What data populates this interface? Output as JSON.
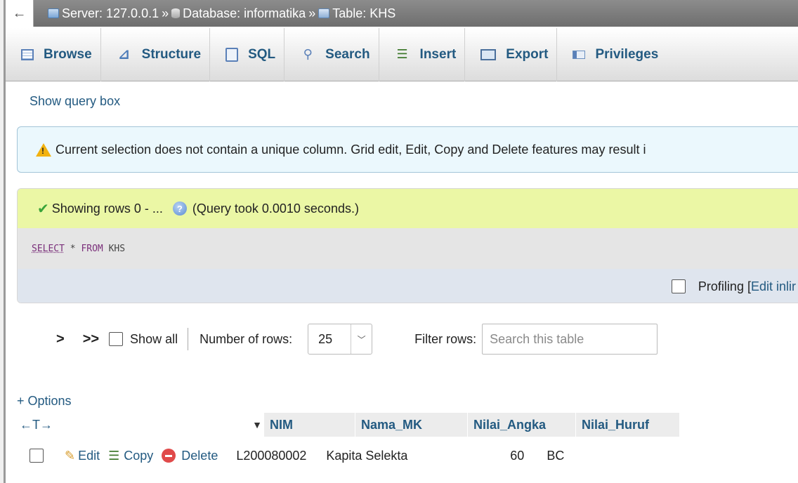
{
  "breadcrumb": {
    "back": "←",
    "server": "Server: 127.0.0.1",
    "database": "Database: informatika",
    "table": "Table: KHS",
    "separator": "»"
  },
  "tabs": [
    {
      "label": "Browse",
      "icon": "browse-icon"
    },
    {
      "label": "Structure",
      "icon": "structure-icon"
    },
    {
      "label": "SQL",
      "icon": "sql-icon"
    },
    {
      "label": "Search",
      "icon": "search-icon"
    },
    {
      "label": "Insert",
      "icon": "insert-icon"
    },
    {
      "label": "Export",
      "icon": "export-icon"
    },
    {
      "label": "Privileges",
      "icon": "privileges-icon"
    }
  ],
  "show_query_box": "Show query box",
  "notice": "Current selection does not contain a unique column. Grid edit, Edit, Copy and Delete features may result i",
  "result": {
    "success_text": "Showing rows 0 - ...",
    "query_time": "(Query took 0.0010 seconds.)",
    "sql_select": "SELECT",
    "sql_rest": " * ",
    "sql_from": "FROM",
    "sql_table": " KHS",
    "profiling_label": "Profiling [",
    "profiling_link": "Edit inlir"
  },
  "navigation": {
    "next": ">",
    "last": ">>",
    "show_all": "Show all",
    "number_of_rows_label": "Number of rows:",
    "number_of_rows_value": "25",
    "filter_label": "Filter rows:",
    "filter_placeholder": "Search this table"
  },
  "options_link": "+ Options",
  "grid": {
    "resize_arrows": "←T→",
    "columns": [
      "NIM",
      "Nama_MK",
      "Nilai_Angka",
      "Nilai_Huruf"
    ],
    "row_actions": {
      "edit": "Edit",
      "copy": "Copy",
      "delete": "Delete"
    },
    "rows": [
      {
        "NIM": "L200080002",
        "Nama_MK": "Kapita Selekta",
        "Nilai_Angka": "60",
        "Nilai_Huruf": "BC"
      }
    ]
  },
  "colors": {
    "link": "#235a81",
    "success_bg": "#ebf7a5",
    "notice_bg": "#ebf8fd"
  }
}
